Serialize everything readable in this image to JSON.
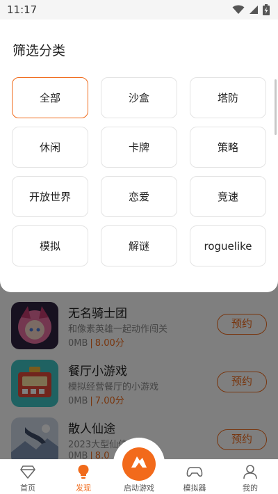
{
  "status_bar": {
    "time": "11:17",
    "icons": [
      "wifi-icon",
      "signal-icon",
      "battery-charging-icon"
    ]
  },
  "filter": {
    "title": "筛选分类",
    "selected": "全部",
    "options": [
      "全部",
      "沙盒",
      "塔防",
      "休闲",
      "卡牌",
      "策略",
      "开放世界",
      "恋爱",
      "竞速",
      "模拟",
      "解谜",
      "roguelike"
    ]
  },
  "games": [
    {
      "title": "无名骑士团",
      "desc": "和像素英雄一起动作闯关",
      "size": "0MB",
      "separator": "|",
      "score": "8.00分",
      "button": "预约"
    },
    {
      "title": "餐厅小游戏",
      "desc": "模拟经营餐厅的小游戏",
      "size": "0MB",
      "separator": "|",
      "score": "7.00分",
      "button": "预约"
    },
    {
      "title": "散人仙途",
      "desc": "2023大型仙侠...作",
      "size": "0MB",
      "separator": "|",
      "score": "8.0",
      "button": "预约"
    }
  ],
  "bottom_nav": {
    "items": [
      {
        "label": "首页",
        "icon": "home-diamond-icon",
        "active": false
      },
      {
        "label": "发现",
        "icon": "lightbulb-icon",
        "active": true
      },
      {
        "label": "启动游戏",
        "icon": "launch-game-icon",
        "active": false
      },
      {
        "label": "模拟器",
        "icon": "gamepad-icon",
        "active": false
      },
      {
        "label": "我的",
        "icon": "profile-icon",
        "active": false
      }
    ]
  },
  "colors": {
    "accent": "#f06a1a",
    "overlay": "rgba(0,0,0,0.5)",
    "chip_border": "#e3e3e3"
  }
}
